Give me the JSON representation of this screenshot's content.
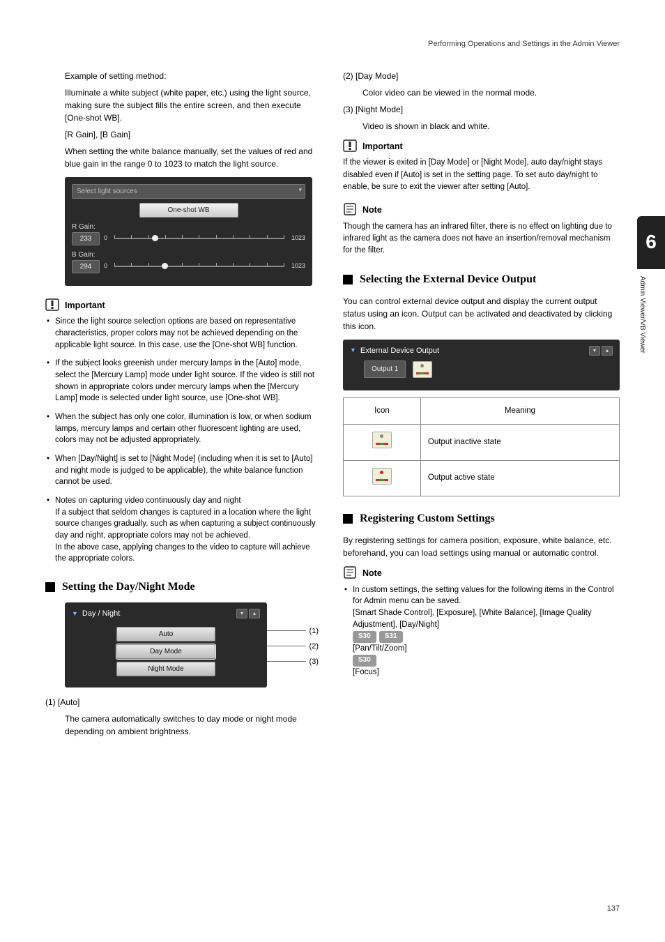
{
  "header": "Performing Operations and Settings in the Admin Viewer",
  "left": {
    "intro": {
      "l1": "Example of setting method:",
      "l2": "Illuminate a white subject (white paper, etc.) using the light source, making sure the subject fills the entire screen, and then execute [One-shot WB].",
      "l3": "[R Gain], [B Gain]",
      "l4": "When setting the white balance manually, set the values of red and blue gain in the range 0 to 1023 to match the light source."
    },
    "panel_wb": {
      "dropdown": "Select light sources",
      "oneshot": "One-shot WB",
      "r_label": "R Gain:",
      "r_val": "233",
      "b_label": "B Gain:",
      "b_val": "294",
      "min": "0",
      "max": "1023"
    },
    "important_label": "Important",
    "important_items": [
      "Since the light source selection options are based on representative characteristics, proper colors may not be achieved depending on the applicable light source. In this case, use the [One-shot WB] function.",
      "If the subject looks greenish under mercury lamps in the [Auto] mode, select the [Mercury Lamp] mode under light source. If the video is still not shown in appropriate colors under mercury lamps when the [Mercury Lamp] mode is selected under light source, use [One-shot WB].",
      "When the subject has only one color, illumination is low, or when sodium lamps, mercury lamps and certain other fluorescent lighting are used, colors may not be adjusted appropriately.",
      "When [Day/Night] is set to [Night Mode] (including when it is set to [Auto] and night mode is judged to be applicable), the white balance function cannot be used.",
      "Notes on capturing video continuously day and night\nIf a subject that seldom changes is captured in a location where the light source changes gradually, such as when capturing a subject continuously day and night, appropriate colors may not be achieved.\nIn the above case, applying changes to the video to capture will achieve the appropriate colors."
    ],
    "section_dn": "Setting the Day/Night Mode",
    "panel_dn": {
      "title": "Day / Night",
      "opts": [
        "Auto",
        "Day Mode",
        "Night Mode"
      ],
      "marks": [
        "(1)",
        "(2)",
        "(3)"
      ]
    },
    "dn_1_t": "(1) [Auto]",
    "dn_1_b": "The camera automatically switches to day mode or night mode depending on ambient brightness."
  },
  "right": {
    "dn_2_t": "(2) [Day Mode]",
    "dn_2_b": "Color video can be viewed in the normal mode.",
    "dn_3_t": "(3) [Night Mode]",
    "dn_3_b": "Video is shown in black and white.",
    "important_label": "Important",
    "imp_text": "If the viewer is exited in [Day Mode] or [Night Mode], auto day/night stays disabled even if [Auto] is set in the setting page. To set auto day/night to enable, be sure to exit the viewer after setting [Auto].",
    "note_label": "Note",
    "note_text": "Though the camera has an infrared filter, there is no effect on lighting due to infrared light as the camera does not have an insertion/removal mechanism for the filter.",
    "section_ext": "Selecting the External Device Output",
    "ext_desc": "You can control external device output and display the current output status using an icon. Output can be activated and deactivated by clicking this icon.",
    "panel_ext": {
      "title": "External Device Output",
      "btn": "Output 1"
    },
    "table": {
      "h1": "Icon",
      "h2": "Meaning",
      "r1": "Output inactive state",
      "r2": "Output active state"
    },
    "section_reg": "Registering Custom Settings",
    "reg_desc": "By registering settings for camera position, exposure, white balance, etc. beforehand, you can load settings using manual or automatic control.",
    "note2_label": "Note",
    "note2_bullet": "In custom settings, the setting values for the following items in the Control for Admin menu can be saved.",
    "note2_line2": "[Smart Shade Control], [Exposure], [White Balance], [Image Quality Adjustment], [Day/Night]",
    "badges1": [
      "S30",
      "S31"
    ],
    "badges1_text": "[Pan/Tilt/Zoom]",
    "badges2": [
      "S30"
    ],
    "badges2_text": "[Focus]"
  },
  "side": {
    "chapter": "6",
    "label": "Admin Viewer/VB Viewer"
  },
  "page_number": "137"
}
